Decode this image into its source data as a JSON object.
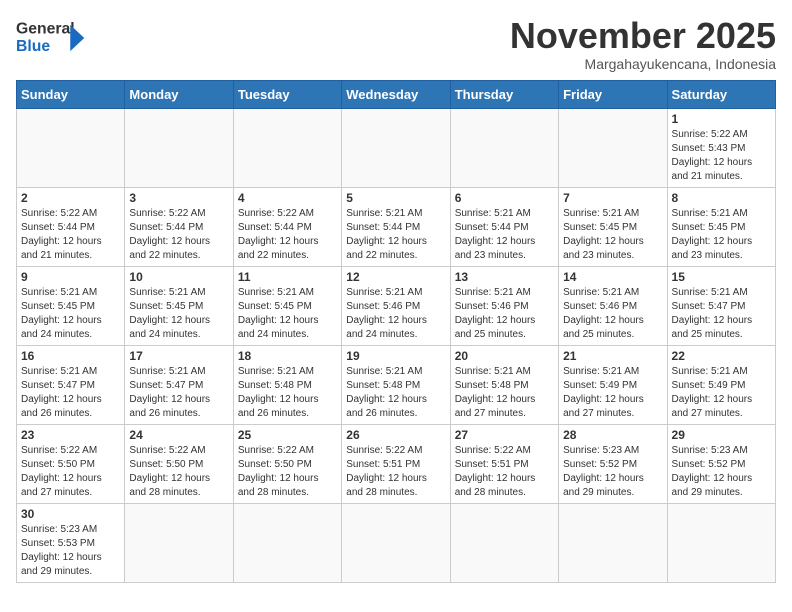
{
  "logo": {
    "text_general": "General",
    "text_blue": "Blue"
  },
  "header": {
    "month_year": "November 2025",
    "subtitle": "Margahayukencana, Indonesia"
  },
  "weekdays": [
    "Sunday",
    "Monday",
    "Tuesday",
    "Wednesday",
    "Thursday",
    "Friday",
    "Saturday"
  ],
  "weeks": [
    [
      {
        "day": "",
        "info": ""
      },
      {
        "day": "",
        "info": ""
      },
      {
        "day": "",
        "info": ""
      },
      {
        "day": "",
        "info": ""
      },
      {
        "day": "",
        "info": ""
      },
      {
        "day": "",
        "info": ""
      },
      {
        "day": "1",
        "info": "Sunrise: 5:22 AM\nSunset: 5:43 PM\nDaylight: 12 hours\nand 21 minutes."
      }
    ],
    [
      {
        "day": "2",
        "info": "Sunrise: 5:22 AM\nSunset: 5:44 PM\nDaylight: 12 hours\nand 21 minutes."
      },
      {
        "day": "3",
        "info": "Sunrise: 5:22 AM\nSunset: 5:44 PM\nDaylight: 12 hours\nand 22 minutes."
      },
      {
        "day": "4",
        "info": "Sunrise: 5:22 AM\nSunset: 5:44 PM\nDaylight: 12 hours\nand 22 minutes."
      },
      {
        "day": "5",
        "info": "Sunrise: 5:21 AM\nSunset: 5:44 PM\nDaylight: 12 hours\nand 22 minutes."
      },
      {
        "day": "6",
        "info": "Sunrise: 5:21 AM\nSunset: 5:44 PM\nDaylight: 12 hours\nand 23 minutes."
      },
      {
        "day": "7",
        "info": "Sunrise: 5:21 AM\nSunset: 5:45 PM\nDaylight: 12 hours\nand 23 minutes."
      },
      {
        "day": "8",
        "info": "Sunrise: 5:21 AM\nSunset: 5:45 PM\nDaylight: 12 hours\nand 23 minutes."
      }
    ],
    [
      {
        "day": "9",
        "info": "Sunrise: 5:21 AM\nSunset: 5:45 PM\nDaylight: 12 hours\nand 24 minutes."
      },
      {
        "day": "10",
        "info": "Sunrise: 5:21 AM\nSunset: 5:45 PM\nDaylight: 12 hours\nand 24 minutes."
      },
      {
        "day": "11",
        "info": "Sunrise: 5:21 AM\nSunset: 5:45 PM\nDaylight: 12 hours\nand 24 minutes."
      },
      {
        "day": "12",
        "info": "Sunrise: 5:21 AM\nSunset: 5:46 PM\nDaylight: 12 hours\nand 24 minutes."
      },
      {
        "day": "13",
        "info": "Sunrise: 5:21 AM\nSunset: 5:46 PM\nDaylight: 12 hours\nand 25 minutes."
      },
      {
        "day": "14",
        "info": "Sunrise: 5:21 AM\nSunset: 5:46 PM\nDaylight: 12 hours\nand 25 minutes."
      },
      {
        "day": "15",
        "info": "Sunrise: 5:21 AM\nSunset: 5:47 PM\nDaylight: 12 hours\nand 25 minutes."
      }
    ],
    [
      {
        "day": "16",
        "info": "Sunrise: 5:21 AM\nSunset: 5:47 PM\nDaylight: 12 hours\nand 26 minutes."
      },
      {
        "day": "17",
        "info": "Sunrise: 5:21 AM\nSunset: 5:47 PM\nDaylight: 12 hours\nand 26 minutes."
      },
      {
        "day": "18",
        "info": "Sunrise: 5:21 AM\nSunset: 5:48 PM\nDaylight: 12 hours\nand 26 minutes."
      },
      {
        "day": "19",
        "info": "Sunrise: 5:21 AM\nSunset: 5:48 PM\nDaylight: 12 hours\nand 26 minutes."
      },
      {
        "day": "20",
        "info": "Sunrise: 5:21 AM\nSunset: 5:48 PM\nDaylight: 12 hours\nand 27 minutes."
      },
      {
        "day": "21",
        "info": "Sunrise: 5:21 AM\nSunset: 5:49 PM\nDaylight: 12 hours\nand 27 minutes."
      },
      {
        "day": "22",
        "info": "Sunrise: 5:21 AM\nSunset: 5:49 PM\nDaylight: 12 hours\nand 27 minutes."
      }
    ],
    [
      {
        "day": "23",
        "info": "Sunrise: 5:22 AM\nSunset: 5:50 PM\nDaylight: 12 hours\nand 27 minutes."
      },
      {
        "day": "24",
        "info": "Sunrise: 5:22 AM\nSunset: 5:50 PM\nDaylight: 12 hours\nand 28 minutes."
      },
      {
        "day": "25",
        "info": "Sunrise: 5:22 AM\nSunset: 5:50 PM\nDaylight: 12 hours\nand 28 minutes."
      },
      {
        "day": "26",
        "info": "Sunrise: 5:22 AM\nSunset: 5:51 PM\nDaylight: 12 hours\nand 28 minutes."
      },
      {
        "day": "27",
        "info": "Sunrise: 5:22 AM\nSunset: 5:51 PM\nDaylight: 12 hours\nand 28 minutes."
      },
      {
        "day": "28",
        "info": "Sunrise: 5:23 AM\nSunset: 5:52 PM\nDaylight: 12 hours\nand 29 minutes."
      },
      {
        "day": "29",
        "info": "Sunrise: 5:23 AM\nSunset: 5:52 PM\nDaylight: 12 hours\nand 29 minutes."
      }
    ],
    [
      {
        "day": "30",
        "info": "Sunrise: 5:23 AM\nSunset: 5:53 PM\nDaylight: 12 hours\nand 29 minutes."
      },
      {
        "day": "",
        "info": ""
      },
      {
        "day": "",
        "info": ""
      },
      {
        "day": "",
        "info": ""
      },
      {
        "day": "",
        "info": ""
      },
      {
        "day": "",
        "info": ""
      },
      {
        "day": "",
        "info": ""
      }
    ]
  ]
}
